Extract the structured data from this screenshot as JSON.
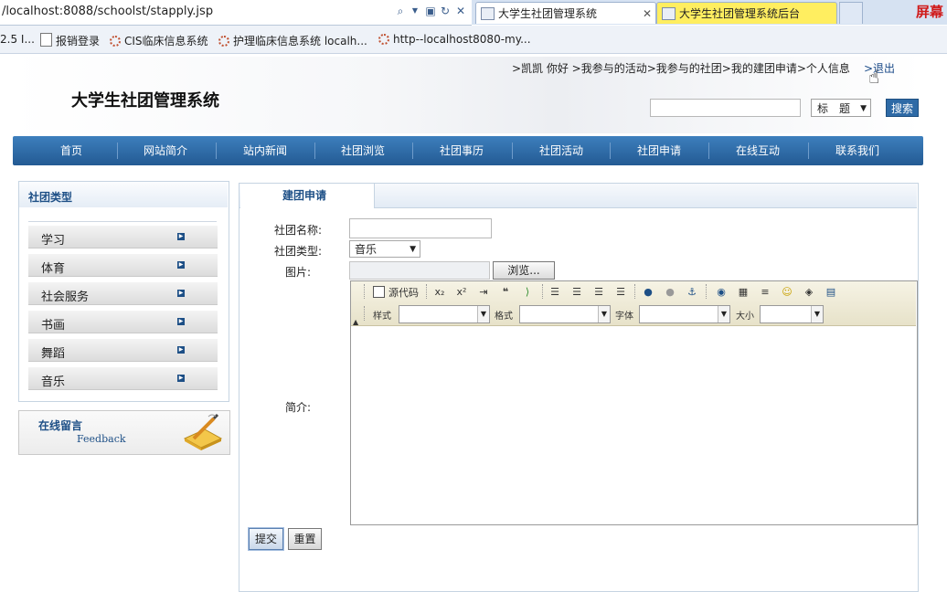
{
  "browser": {
    "url": "/localhost:8088/schoolst/stapply.jsp",
    "tabs": [
      {
        "title": "大学生社团管理系统"
      },
      {
        "title": "大学生社团管理系统后台"
      }
    ],
    "overlay_text": "屏幕",
    "favorites": [
      {
        "label": "2.5 I..."
      },
      {
        "label": "报销登录"
      },
      {
        "label": "CIS临床信息系统"
      },
      {
        "label": "护理临床信息系统 localh..."
      },
      {
        "label": "http--localhost8080-my..."
      }
    ]
  },
  "header": {
    "user_links": ">凯凯  你好    >我参与的活动>我参与的社团>我的建团申请>个人信息",
    "logout": ">退出",
    "site_title": "大学生社团管理系统",
    "search": {
      "placeholder": "",
      "select_value": "标　题",
      "button": "搜索"
    }
  },
  "nav": {
    "items": [
      "首页",
      "网站简介",
      "站内新闻",
      "社团浏览",
      "社团事历",
      "社团活动",
      "社团申请",
      "在线互动",
      "联系我们"
    ]
  },
  "sidebar": {
    "title": "社团类型",
    "categories": [
      "学习",
      "体育",
      "社会服务",
      "书画",
      "舞蹈",
      "音乐"
    ],
    "feedback": {
      "title": "在线留言",
      "subtitle": "Feedback"
    }
  },
  "main": {
    "tab_title": "建团申请",
    "form": {
      "name_label": "社团名称:",
      "name_value": "",
      "type_label": "社团类型:",
      "type_value": "音乐",
      "image_label": "图片:",
      "browse_button": "浏览...",
      "intro_label": "简介:",
      "submit": "提交",
      "reset": "重置"
    },
    "editor": {
      "source_button": "源代码",
      "style_label": "样式",
      "format_label": "格式",
      "font_label": "字体",
      "size_label": "大小"
    }
  },
  "colors": {
    "nav_bg": "#2e6aa6",
    "accent": "#1d4f86",
    "tab_highlight": "#ffee60"
  }
}
